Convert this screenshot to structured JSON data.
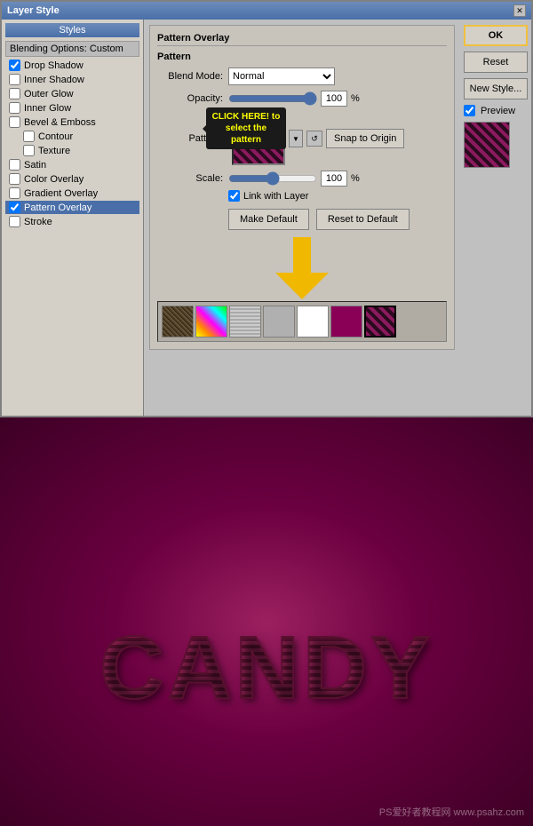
{
  "dialog": {
    "title": "Layer Style",
    "close_label": "✕"
  },
  "left_panel": {
    "styles_header": "Styles",
    "blending_options": "Blending Options: Custom",
    "items": [
      {
        "id": "drop-shadow",
        "label": "Drop Shadow",
        "checked": true,
        "active": false,
        "sub": false
      },
      {
        "id": "inner-shadow",
        "label": "Inner Shadow",
        "checked": false,
        "active": false,
        "sub": false
      },
      {
        "id": "outer-glow",
        "label": "Outer Glow",
        "checked": false,
        "active": false,
        "sub": false
      },
      {
        "id": "inner-glow",
        "label": "Inner Glow",
        "checked": false,
        "active": false,
        "sub": false
      },
      {
        "id": "bevel-emboss",
        "label": "Bevel & Emboss",
        "checked": false,
        "active": false,
        "sub": false
      },
      {
        "id": "contour",
        "label": "Contour",
        "checked": false,
        "active": false,
        "sub": true
      },
      {
        "id": "texture",
        "label": "Texture",
        "checked": false,
        "active": false,
        "sub": true
      },
      {
        "id": "satin",
        "label": "Satin",
        "checked": false,
        "active": false,
        "sub": false
      },
      {
        "id": "color-overlay",
        "label": "Color Overlay",
        "checked": false,
        "active": false,
        "sub": false
      },
      {
        "id": "gradient-overlay",
        "label": "Gradient Overlay",
        "checked": false,
        "active": false,
        "sub": false
      },
      {
        "id": "pattern-overlay",
        "label": "Pattern Overlay",
        "checked": true,
        "active": true,
        "sub": false
      },
      {
        "id": "stroke",
        "label": "Stroke",
        "checked": false,
        "active": false,
        "sub": false
      }
    ]
  },
  "pattern_panel": {
    "title": "Pattern Overlay",
    "sub_title": "Pattern",
    "blend_mode_label": "Blend Mode:",
    "blend_mode_value": "Normal",
    "opacity_label": "Opacity:",
    "opacity_value": "100",
    "opacity_percent": "%",
    "pattern_label": "Pattern:",
    "snap_origin_label": "Snap to Origin",
    "scale_label": "Scale:",
    "scale_value": "100",
    "scale_percent": "%",
    "link_layer_label": "Link with Layer",
    "link_layer_checked": true,
    "make_default_label": "Make Default",
    "reset_default_label": "Reset to Default",
    "callout_text": "CLICK HERE! to select the pattern"
  },
  "right_buttons": {
    "ok_label": "OK",
    "reset_label": "Reset",
    "new_style_label": "New Style...",
    "preview_label": "Preview"
  },
  "canvas": {
    "text": "CANDY",
    "watermark": "PS爱好者教程网  www.psahz.com"
  }
}
